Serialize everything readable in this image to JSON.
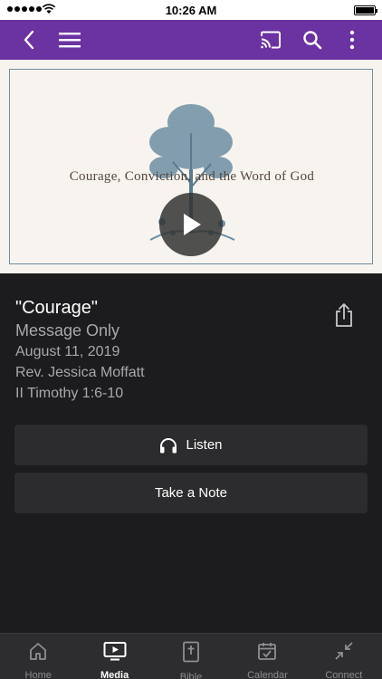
{
  "status_bar": {
    "time": "10:26 AM"
  },
  "nav": {
    "back_icon": "chevron-left-icon",
    "menu_icon": "hamburger-menu-icon",
    "cast_icon": "cast-icon",
    "search_icon": "search-icon",
    "more_icon": "more-vertical-icon",
    "background_color": "#6b32a1"
  },
  "video": {
    "thumbnail_title": "Courage, Conviction, and the Word of God",
    "play_icon": "play-icon"
  },
  "message": {
    "title": "\"Courage\"",
    "subtitle": "Message Only",
    "date": "August 11, 2019",
    "speaker": "Rev. Jessica Moffatt",
    "scripture": "II Timothy 1:6-10",
    "share_icon": "share-icon"
  },
  "actions": {
    "listen_label": "Listen",
    "listen_icon": "headphones-icon",
    "note_label": "Take a Note"
  },
  "tabs": [
    {
      "label": "Home",
      "icon": "home-icon",
      "active": false
    },
    {
      "label": "Media",
      "icon": "media-icon",
      "active": true
    },
    {
      "label": "Bible",
      "icon": "bible-icon",
      "active": false
    },
    {
      "label": "Calendar",
      "icon": "calendar-icon",
      "active": false
    },
    {
      "label": "Connect",
      "icon": "connect-icon",
      "active": false
    }
  ]
}
